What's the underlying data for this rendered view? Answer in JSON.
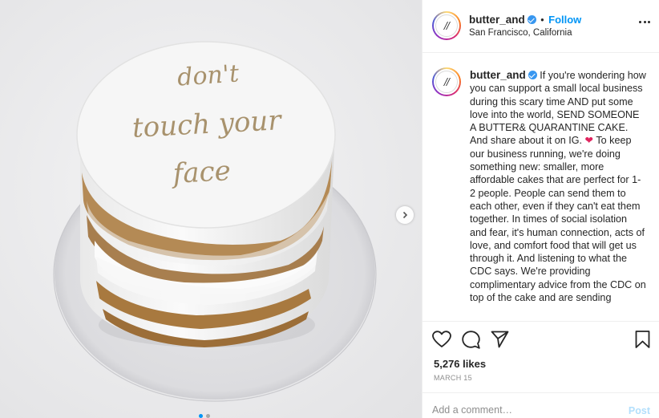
{
  "post": {
    "username": "butter_and",
    "avatar_text": "//",
    "follow_label": "Follow",
    "dot": "•",
    "location": "San Francisco, California"
  },
  "image": {
    "cake_text_line1": "don't",
    "cake_text_line2": "touch your",
    "cake_text_line3": "face"
  },
  "caption": {
    "username": "butter_and",
    "part1": "If you're wondering how you can support a small local business during this scary time AND put some love into the world, SEND SOMEONE A BUTTER& QUARANTINE CAKE. And share about it on IG. ",
    "heart": "❤",
    "part2": " To keep our business running, we're doing something new: smaller, more affordable cakes that are perfect for 1-2 people. People can send them to each other, even if they can't eat them together. In times of social isolation and fear, it's human connection, acts of love, and comfort food that will get us through it. And listening to what the CDC says. We're providing complimentary advice from the CDC on top of the cake and are sending"
  },
  "stats": {
    "likes": "5,276 likes",
    "date": "MARCH 15"
  },
  "comment": {
    "placeholder": "Add a comment…",
    "post_label": "Post"
  },
  "icons": {
    "header_more": "more-options-icon",
    "verified": "verified-badge-icon",
    "like": "heart-outline-icon",
    "comment": "comment-bubble-icon",
    "share": "paper-plane-icon",
    "save": "bookmark-icon",
    "carousel_next": "chevron-right-icon"
  },
  "colors": {
    "link_blue": "#0095f6",
    "verified_blue": "#3897f0",
    "post_disabled": "#b2dffc",
    "cake_lettering": "#a8926d"
  }
}
